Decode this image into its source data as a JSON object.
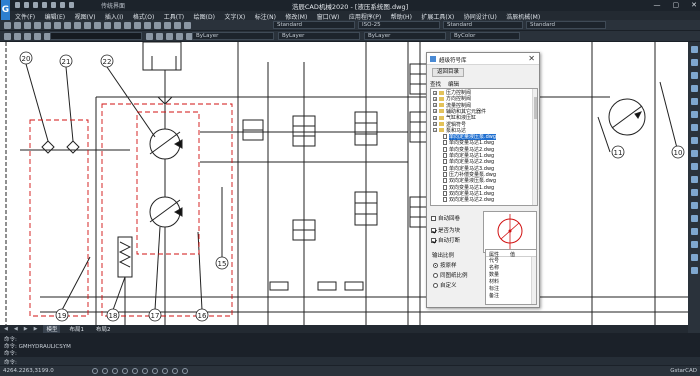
{
  "app": {
    "title": "浩辰CAD机械2020 - [液压系统图.dwg]",
    "quick_access_label": "传统界面",
    "window_buttons": [
      "—",
      "▢",
      "✕"
    ]
  },
  "menu": [
    "文件(F)",
    "编辑(E)",
    "视图(V)",
    "插入(I)",
    "格式(O)",
    "工具(T)",
    "绘图(D)",
    "文字(X)",
    "标注(N)",
    "修改(M)",
    "窗口(W)",
    "应用程序(P)",
    "帮助(H)",
    "扩展工具(X)",
    "协同设计(U)",
    "浩辰机械(M)"
  ],
  "toolbar": {
    "text_style": "Standard",
    "dim_style": "ISO-25",
    "table_style": "Standard",
    "multileader_style": "Standard",
    "layer_color": "ByLayer",
    "linetype": "ByLayer",
    "lineweight": "ByLayer",
    "plot_style": "ByColor"
  },
  "drawing": {
    "labels": [
      "20",
      "21",
      "22",
      "19",
      "18",
      "17",
      "16",
      "15",
      "11",
      "10"
    ]
  },
  "layout_tabs": [
    "模型",
    "布局1",
    "布局2"
  ],
  "command": {
    "history": [
      "命令:",
      "命令: GMHYDRAULICSYM",
      "命令:"
    ],
    "input_prompt": "命令:"
  },
  "status": {
    "coordinates": "4264.2263,3199.0",
    "brand": "GstarCAD"
  },
  "dialog": {
    "title": "超级符号库",
    "back_button": "返回目录",
    "tabs": [
      "查找",
      "编辑"
    ],
    "tree": [
      {
        "label": "压力控制阀",
        "kind": "folder",
        "level": 1
      },
      {
        "label": "方向控制阀",
        "kind": "folder",
        "level": 1
      },
      {
        "label": "流量控制阀",
        "kind": "folder",
        "level": 1
      },
      {
        "label": "辅助和其它元器件",
        "kind": "folder",
        "level": 1
      },
      {
        "label": "气缸和液压缸",
        "kind": "folder",
        "level": 1
      },
      {
        "label": "逻辑符号",
        "kind": "folder",
        "level": 1
      },
      {
        "label": "泵和马达",
        "kind": "folder",
        "level": 1,
        "expanded": true
      },
      {
        "label": "单向定量液压泵.dwg",
        "kind": "file",
        "level": 2,
        "selected": true
      },
      {
        "label": "单向变量马达1.dwg",
        "kind": "file",
        "level": 2
      },
      {
        "label": "单向变量马达2.dwg",
        "kind": "file",
        "level": 2
      },
      {
        "label": "单向定量马达1.dwg",
        "kind": "file",
        "level": 2
      },
      {
        "label": "单向定量马达2.dwg",
        "kind": "file",
        "level": 2
      },
      {
        "label": "单向定量马达3.dwg",
        "kind": "file",
        "level": 2
      },
      {
        "label": "压力补偿变量泵.dwg",
        "kind": "file",
        "level": 2
      },
      {
        "label": "双向定量液压泵.dwg",
        "kind": "file",
        "level": 2
      },
      {
        "label": "双向变量马达1.dwg",
        "kind": "file",
        "level": 2
      },
      {
        "label": "双向定量马达1.dwg",
        "kind": "file",
        "level": 2
      },
      {
        "label": "双向定量马达2.dwg",
        "kind": "file",
        "level": 2
      }
    ],
    "options": {
      "auto_explode": {
        "label": "自动回卷",
        "checked": false
      },
      "is_block": {
        "label": "是否为块",
        "checked": true
      },
      "auto_break": {
        "label": "自动打断",
        "checked": true
      }
    },
    "scale": {
      "title": "输出比例",
      "options": [
        "按原样",
        "同图纸比例",
        "自定义"
      ],
      "selected": 0
    },
    "properties": {
      "headers": [
        "属性",
        "值"
      ],
      "rows": [
        "代号",
        "名称",
        "数量",
        "材料",
        "标注",
        "备注"
      ]
    }
  }
}
